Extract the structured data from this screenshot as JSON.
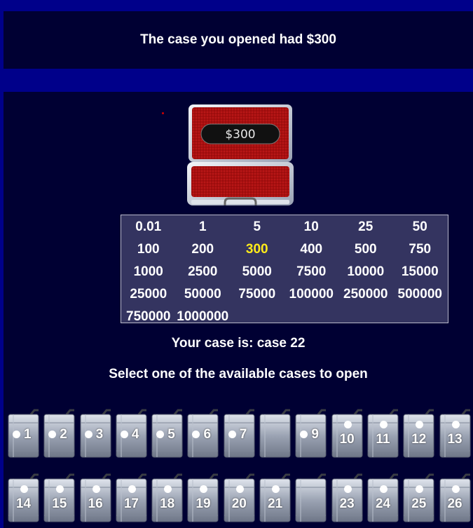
{
  "banner": {
    "message": "The case you opened had $300"
  },
  "opened_case": {
    "amount_label": "$300"
  },
  "prize_board": {
    "rows": [
      [
        "0.01",
        "1",
        "5",
        "10",
        "25",
        "50"
      ],
      [
        "100",
        "200",
        "300",
        "400",
        "500",
        "750"
      ],
      [
        "1000",
        "2500",
        "5000",
        "7500",
        "10000",
        "15000"
      ],
      [
        "25000",
        "50000",
        "75000",
        "100000",
        "250000",
        "500000"
      ],
      [
        "750000",
        "1000000"
      ]
    ],
    "highlighted": "300",
    "highlight_color": "#ffeb1a"
  },
  "your_case_text": "Your case is: case 22",
  "instruction_text": "Select one of the available cases to open",
  "case_rows": [
    [
      {
        "number": "1",
        "available": true
      },
      {
        "number": "2",
        "available": true
      },
      {
        "number": "3",
        "available": true
      },
      {
        "number": "4",
        "available": true
      },
      {
        "number": "5",
        "available": true
      },
      {
        "number": "6",
        "available": true
      },
      {
        "number": "7",
        "available": true
      },
      {
        "number": "",
        "available": false
      },
      {
        "number": "9",
        "available": true
      },
      {
        "number": "10",
        "available": true
      },
      {
        "number": "11",
        "available": true
      },
      {
        "number": "12",
        "available": true
      },
      {
        "number": "13",
        "available": true
      }
    ],
    [
      {
        "number": "14",
        "available": true
      },
      {
        "number": "15",
        "available": true
      },
      {
        "number": "16",
        "available": true
      },
      {
        "number": "17",
        "available": true
      },
      {
        "number": "18",
        "available": true
      },
      {
        "number": "19",
        "available": true
      },
      {
        "number": "20",
        "available": true
      },
      {
        "number": "21",
        "available": true
      },
      {
        "number": "",
        "available": false
      },
      {
        "number": "23",
        "available": true
      },
      {
        "number": "24",
        "available": true
      },
      {
        "number": "25",
        "available": true
      },
      {
        "number": "26",
        "available": true
      }
    ]
  ],
  "colors": {
    "background": "#00008a",
    "panel": "#000033",
    "board": "#343460",
    "briefcase_lining": "#b01010"
  }
}
